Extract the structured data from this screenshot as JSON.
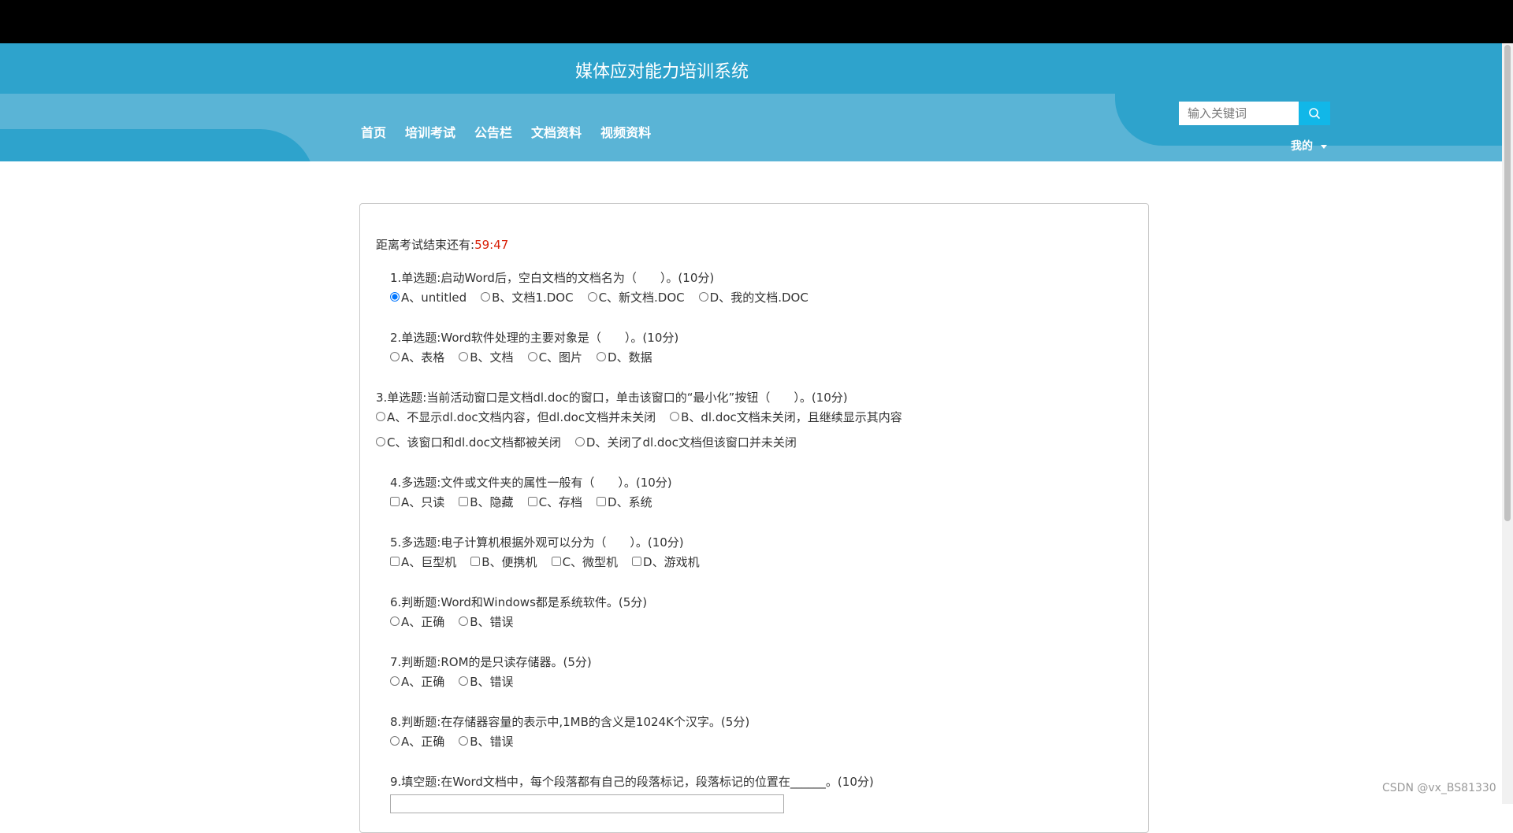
{
  "app": {
    "title": "媒体应对能力培训系统"
  },
  "nav": {
    "items": [
      "首页",
      "培训考试",
      "公告栏",
      "文档资料",
      "视频资料"
    ]
  },
  "search": {
    "placeholder": "输入关键词",
    "icon": "search-icon"
  },
  "user_menu": {
    "label": "我的"
  },
  "exam": {
    "timer_label": "距离考试结束还有:",
    "time_remaining": "59:47",
    "questions": [
      {
        "stem": "1.单选题:启动Word后，空白文档的文档名为（　　）。(10分)",
        "type": "radio",
        "options": [
          "A、untitled",
          "B、文档1.DOC",
          "C、新文档.DOC",
          "D、我的文档.DOC"
        ],
        "selected": 0
      },
      {
        "stem": "2.单选题:Word软件处理的主要对象是（　　）。(10分)",
        "type": "radio",
        "options": [
          "A、表格",
          "B、文档",
          "C、图片",
          "D、数据"
        ]
      },
      {
        "stem": "3.单选题:当前活动窗口是文档dl.doc的窗口，单击该窗口的“最小化”按钮（　　）。(10分)",
        "type": "radio",
        "options": [
          "A、不显示dl.doc文档内容，但dl.doc文档并未关闭",
          "B、dl.doc文档未关闭，且继续显示其内容",
          "C、该窗口和dl.doc文档都被关闭",
          "D、关闭了dl.doc文档但该窗口并未关闭"
        ]
      },
      {
        "stem": "4.多选题:文件或文件夹的属性一般有（　　）。(10分)",
        "type": "checkbox",
        "options": [
          "A、只读",
          "B、隐藏",
          "C、存档",
          "D、系统"
        ]
      },
      {
        "stem": "5.多选题:电子计算机根据外观可以分为（　　）。(10分)",
        "type": "checkbox",
        "options": [
          "A、巨型机",
          "B、便携机",
          "C、微型机",
          "D、游戏机"
        ]
      },
      {
        "stem": "6.判断题:Word和Windows都是系统软件。(5分)",
        "type": "radio",
        "options": [
          "A、正确",
          "B、错误"
        ]
      },
      {
        "stem": "7.判断题:ROM的是只读存储器。(5分)",
        "type": "radio",
        "options": [
          "A、正确",
          "B、错误"
        ]
      },
      {
        "stem": "8.判断题:在存储器容量的表示中,1MB的含义是1024K个汉字。(5分)",
        "type": "radio",
        "options": [
          "A、正确",
          "B、错误"
        ]
      },
      {
        "stem": "9.填空题:在Word文档中，每个段落都有自己的段落标记，段落标记的位置在______。(10分)",
        "type": "fill"
      }
    ]
  },
  "watermark": "CSDN @vx_BS81330"
}
